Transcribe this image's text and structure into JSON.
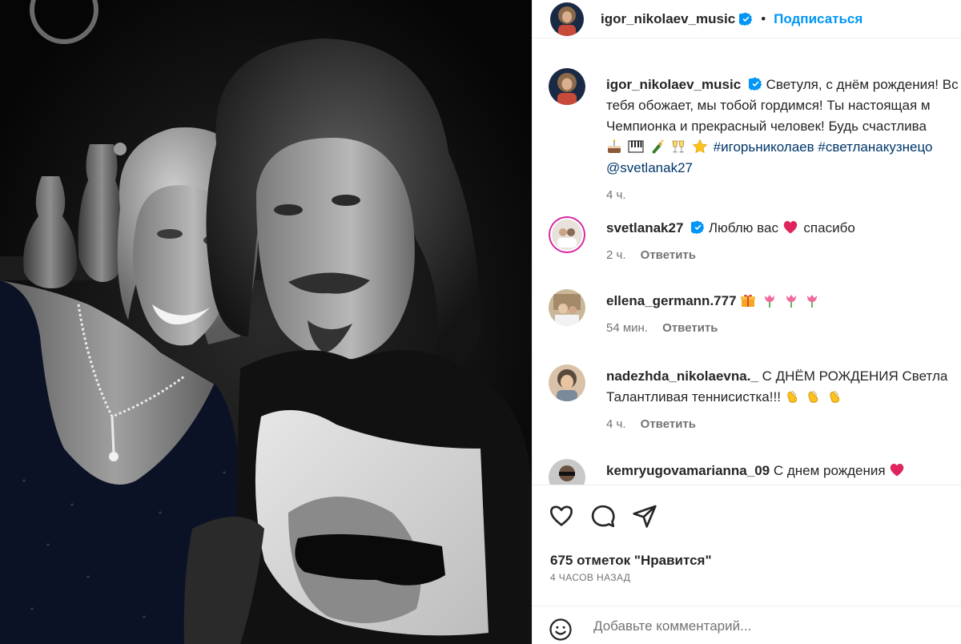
{
  "header": {
    "username": "igor_nikolaev_music",
    "separator": "•",
    "follow_label": "Подписаться"
  },
  "caption": {
    "username": "igor_nikolaev_music",
    "line1": "Светуля, с днём рождения! Вс",
    "line2": "тебя обожает, мы тобой гордимся! Ты настоящая м",
    "line3": "Чемпионка и прекрасный человек! Будь счастлива",
    "emoji_names": [
      "cake-emoji",
      "piano-emoji",
      "champagne-emoji",
      "clinking-glasses-emoji",
      "star-emoji"
    ],
    "hashtag1": "#игорьниколаев",
    "hashtag2": "#светланакузнецо",
    "mention": "@svetlanak27",
    "time": "4 ч."
  },
  "comments": [
    {
      "username": "svetlanak27",
      "verified": true,
      "text_before": "Люблю вас",
      "text_after": "спасибо",
      "emoji_names": [
        "red-heart-emoji"
      ],
      "time": "2 ч.",
      "reply_label": "Ответить"
    },
    {
      "username": "ellena_germann.777",
      "verified": false,
      "text_before": "",
      "text_after": "",
      "emoji_names": [
        "gift-emoji",
        "tulip-emoji",
        "tulip-emoji",
        "tulip-emoji"
      ],
      "time": "54 мин.",
      "reply_label": "Ответить"
    },
    {
      "username": "nadezhda_nikolaevna._",
      "verified": false,
      "line1": "С ДНЁМ РОЖДЕНИЯ Светла",
      "line2": "Талантливая теннисистка!!!",
      "emoji_names": [
        "clapping-hands-emoji",
        "clapping-hands-emoji",
        "clapping-hands-emoji"
      ],
      "time": "4 ч.",
      "reply_label": "Ответить"
    },
    {
      "username": "kemryugovamarianna_09",
      "verified": false,
      "text_before": "С днем рождения",
      "emoji_names": [
        "red-heart-emoji"
      ]
    }
  ],
  "actions": {
    "icons": [
      "heart-icon",
      "comment-icon",
      "share-icon"
    ],
    "likes_label": "675 отметок \"Нравится\"",
    "timestamp": "4 ЧАСОВ НАЗАД"
  },
  "add_comment": {
    "placeholder": "Добавьте комментарий..."
  },
  "colors": {
    "accent": "#0095f6",
    "verified": "#0095f6",
    "hashtag": "#00376b",
    "secondary_text": "#737373",
    "heart_red": "#e0245e"
  }
}
